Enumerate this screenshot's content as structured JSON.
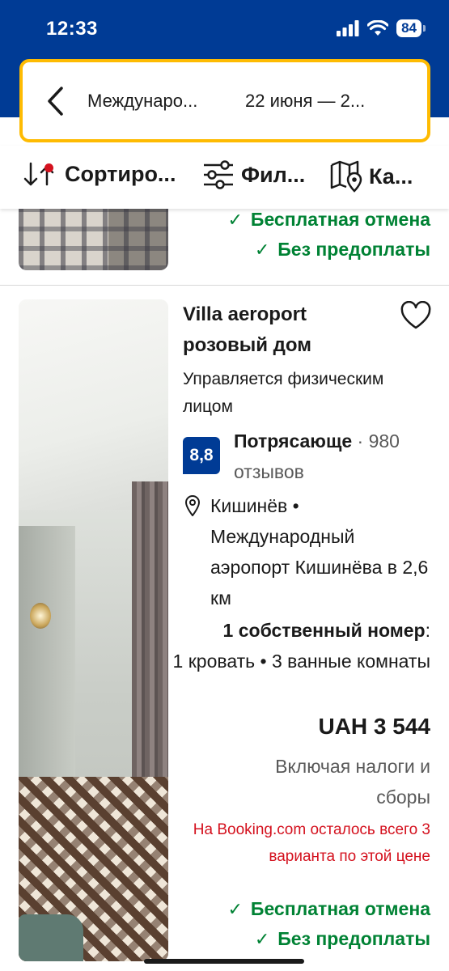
{
  "status_bar": {
    "time": "12:33",
    "battery": "84"
  },
  "search": {
    "destination": "Междунаро...",
    "dates": "22 июня — 2..."
  },
  "toolbar": {
    "sort_label": "Сортиро...",
    "filter_label": "Фил...",
    "map_label": "Ка..."
  },
  "prev_card": {
    "free_cancel": "Бесплатная отмена",
    "no_prepay": "Без предоплаты"
  },
  "property": {
    "title": "Villa aeroport розовый дом",
    "managed_by": "Управляется физическим лицом",
    "score": "8,8",
    "score_word": "Потрясающе",
    "reviews": "· 980 отзывов",
    "location": "Кишинёв • Международный аэропорт Кишинёва в 2,6 км",
    "room_type": "1 собственный номер",
    "room_colon": ":",
    "room_details": "1 кровать • 3 ванные комнаты",
    "price": "UAH 3 544",
    "taxes": "Включая налоги и сборы",
    "scarcity": "На Booking.com осталось всего 3 варианта по этой цене",
    "free_cancel": "Бесплатная отмена",
    "no_prepay": "Без предоплаты"
  },
  "colors": {
    "brand_blue": "#003b95",
    "search_border": "#febb02",
    "green": "#008234",
    "red": "#d4111e"
  },
  "icons": [
    "signal-icon",
    "wifi-icon",
    "battery-icon",
    "back-arrow-icon",
    "sort-icon",
    "filter-icon",
    "map-icon",
    "heart-icon",
    "location-pin-icon",
    "check-icon"
  ]
}
